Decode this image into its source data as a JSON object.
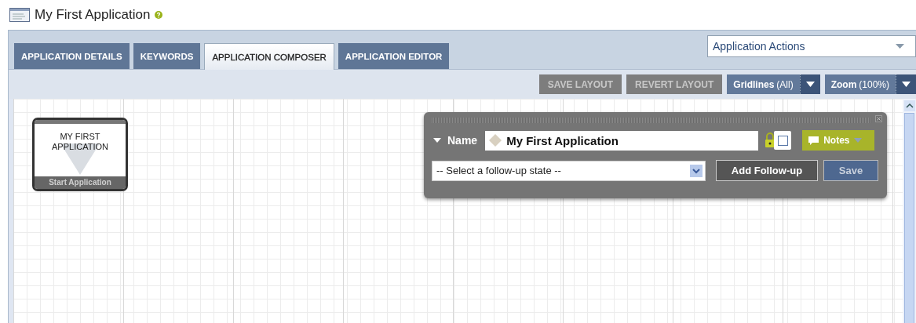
{
  "page": {
    "title": "My First Application"
  },
  "tabs": [
    {
      "label": "APPLICATION DETAILS",
      "selected": false
    },
    {
      "label": "KEYWORDS",
      "selected": false
    },
    {
      "label": "APPLICATION COMPOSER",
      "selected": true
    },
    {
      "label": "APPLICATION EDITOR",
      "selected": false
    }
  ],
  "actions_dropdown": {
    "value": "Application Actions"
  },
  "toolbar": {
    "buttons": [
      {
        "label": "SAVE LAYOUT",
        "disabled": true
      },
      {
        "label": "REVERT LAYOUT",
        "disabled": true
      }
    ],
    "gridlines": {
      "label": "Gridlines",
      "value": "(All)"
    },
    "zoom": {
      "label": "Zoom",
      "value": "(100%)"
    }
  },
  "node": {
    "title": "MY FIRST APPLICATION",
    "footer": "Start Application"
  },
  "editor": {
    "name_label": "Name",
    "name_value": "My First Application",
    "locked": {
      "checked": false
    },
    "notes_button": "Notes",
    "followup_select": {
      "value": "-- Select a follow-up state --"
    },
    "add_button": "Add Follow-up",
    "save_button": "Save"
  }
}
